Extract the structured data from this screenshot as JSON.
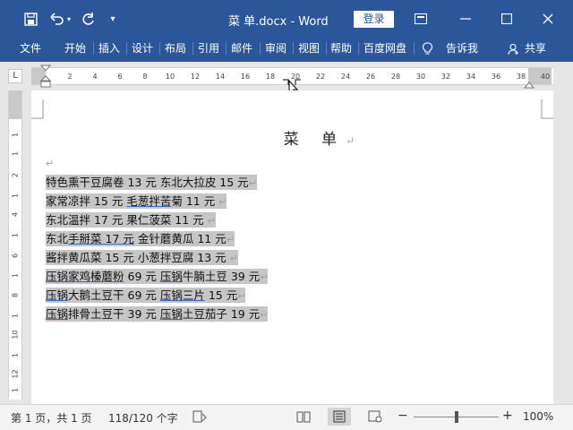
{
  "window": {
    "title": "菜 单.docx  -  Word",
    "login_label": "登录"
  },
  "quick_access": {
    "save_icon": "save-icon",
    "undo_icon": "undo-icon",
    "redo_icon": "redo-icon",
    "customize_icon": "customize-quick-access-icon"
  },
  "ribbon": {
    "tabs": [
      "文件",
      "开始",
      "插入",
      "设计",
      "布局",
      "引用",
      "邮件",
      "审阅",
      "视图",
      "帮助",
      "百度网盘",
      "告诉我",
      "共享"
    ],
    "accent": "#2b579a"
  },
  "ruler": {
    "corner_label": "L",
    "ticks": [
      "2",
      "4",
      "6",
      "8",
      "10",
      "12",
      "14",
      "16",
      "18",
      "20",
      "22",
      "24",
      "26",
      "28",
      "30",
      "32",
      "34",
      "36",
      "38",
      "40"
    ],
    "vticks": [
      "1",
      "1",
      "2",
      "1",
      "4",
      "1",
      "6",
      "1",
      "8",
      "1",
      "10",
      "1",
      "12",
      "1",
      "14"
    ]
  },
  "document": {
    "title": "菜   单",
    "lines": [
      [
        {
          "t": "特色熏干豆腐卷 13 元  东北大拉皮 15 元",
          "u": false
        }
      ],
      [
        {
          "t": "家常凉拌 15 元  ",
          "u": false
        },
        {
          "t": "毛葱拌苦",
          "u": true
        },
        {
          "t": "菊 11 元  ",
          "u": false
        }
      ],
      [
        {
          "t": "东北温拌 17 元  果仁菠菜 11 元  ",
          "u": false
        }
      ],
      [
        {
          "t": "东北",
          "u": false
        },
        {
          "t": "手掰菜 17 元",
          "u": true
        },
        {
          "t": "  金针蘑黄瓜 11 元",
          "u": false
        }
      ],
      [
        {
          "t": "酱拌黄瓜菜 15 元  小葱拌豆腐 13 元  ",
          "u": false
        }
      ],
      [
        {
          "t": "压锅家鸡榛蘑粉",
          "u": true
        },
        {
          "t": " 69 元  ",
          "u": false
        },
        {
          "t": "压锅",
          "u": true
        },
        {
          "t": "牛腩土豆 39 元",
          "u": false
        }
      ],
      [
        {
          "t": "压锅",
          "u": true
        },
        {
          "t": "大鹅土豆干 69 元  ",
          "u": false
        },
        {
          "t": "压锅三片",
          "u": true
        },
        {
          "t": " 15 元",
          "u": false
        }
      ],
      [
        {
          "t": "压锅",
          "u": true
        },
        {
          "t": "排骨土豆干 39 元  ",
          "u": false
        },
        {
          "t": "压锅",
          "u": true
        },
        {
          "t": "土豆茄子 19 元",
          "u": false
        }
      ]
    ],
    "selection_color": "#c6c6c6"
  },
  "statusbar": {
    "page_info": "第 1 页，共 1 页",
    "word_count": "118/120 个字",
    "zoom_minus": "−",
    "zoom_plus": "+",
    "zoom_level": "100%",
    "zoom_fraction": 0.5
  }
}
